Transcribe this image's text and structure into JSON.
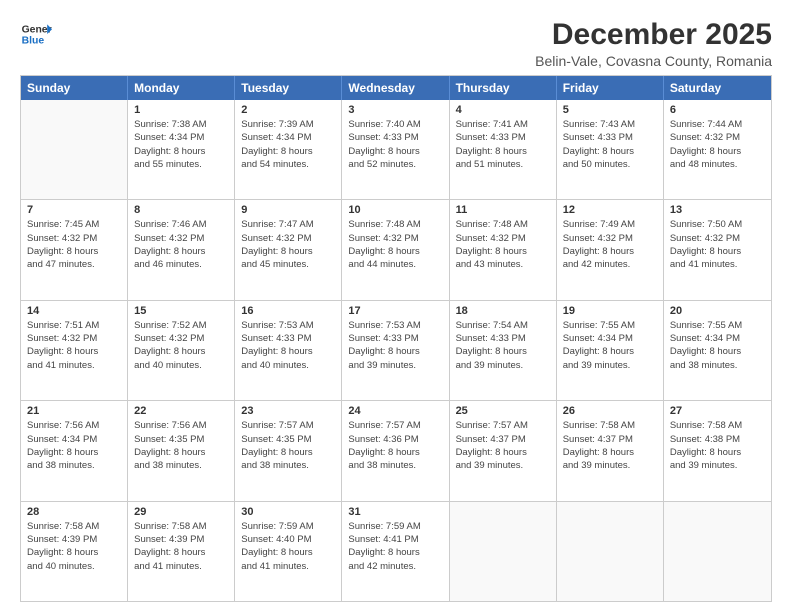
{
  "logo": {
    "line1": "General",
    "line2": "Blue"
  },
  "title": "December 2025",
  "subtitle": "Belin-Vale, Covasna County, Romania",
  "header_days": [
    "Sunday",
    "Monday",
    "Tuesday",
    "Wednesday",
    "Thursday",
    "Friday",
    "Saturday"
  ],
  "weeks": [
    [
      {
        "day": "",
        "info": ""
      },
      {
        "day": "1",
        "info": "Sunrise: 7:38 AM\nSunset: 4:34 PM\nDaylight: 8 hours\nand 55 minutes."
      },
      {
        "day": "2",
        "info": "Sunrise: 7:39 AM\nSunset: 4:34 PM\nDaylight: 8 hours\nand 54 minutes."
      },
      {
        "day": "3",
        "info": "Sunrise: 7:40 AM\nSunset: 4:33 PM\nDaylight: 8 hours\nand 52 minutes."
      },
      {
        "day": "4",
        "info": "Sunrise: 7:41 AM\nSunset: 4:33 PM\nDaylight: 8 hours\nand 51 minutes."
      },
      {
        "day": "5",
        "info": "Sunrise: 7:43 AM\nSunset: 4:33 PM\nDaylight: 8 hours\nand 50 minutes."
      },
      {
        "day": "6",
        "info": "Sunrise: 7:44 AM\nSunset: 4:32 PM\nDaylight: 8 hours\nand 48 minutes."
      }
    ],
    [
      {
        "day": "7",
        "info": "Sunrise: 7:45 AM\nSunset: 4:32 PM\nDaylight: 8 hours\nand 47 minutes."
      },
      {
        "day": "8",
        "info": "Sunrise: 7:46 AM\nSunset: 4:32 PM\nDaylight: 8 hours\nand 46 minutes."
      },
      {
        "day": "9",
        "info": "Sunrise: 7:47 AM\nSunset: 4:32 PM\nDaylight: 8 hours\nand 45 minutes."
      },
      {
        "day": "10",
        "info": "Sunrise: 7:48 AM\nSunset: 4:32 PM\nDaylight: 8 hours\nand 44 minutes."
      },
      {
        "day": "11",
        "info": "Sunrise: 7:48 AM\nSunset: 4:32 PM\nDaylight: 8 hours\nand 43 minutes."
      },
      {
        "day": "12",
        "info": "Sunrise: 7:49 AM\nSunset: 4:32 PM\nDaylight: 8 hours\nand 42 minutes."
      },
      {
        "day": "13",
        "info": "Sunrise: 7:50 AM\nSunset: 4:32 PM\nDaylight: 8 hours\nand 41 minutes."
      }
    ],
    [
      {
        "day": "14",
        "info": "Sunrise: 7:51 AM\nSunset: 4:32 PM\nDaylight: 8 hours\nand 41 minutes."
      },
      {
        "day": "15",
        "info": "Sunrise: 7:52 AM\nSunset: 4:32 PM\nDaylight: 8 hours\nand 40 minutes."
      },
      {
        "day": "16",
        "info": "Sunrise: 7:53 AM\nSunset: 4:33 PM\nDaylight: 8 hours\nand 40 minutes."
      },
      {
        "day": "17",
        "info": "Sunrise: 7:53 AM\nSunset: 4:33 PM\nDaylight: 8 hours\nand 39 minutes."
      },
      {
        "day": "18",
        "info": "Sunrise: 7:54 AM\nSunset: 4:33 PM\nDaylight: 8 hours\nand 39 minutes."
      },
      {
        "day": "19",
        "info": "Sunrise: 7:55 AM\nSunset: 4:34 PM\nDaylight: 8 hours\nand 39 minutes."
      },
      {
        "day": "20",
        "info": "Sunrise: 7:55 AM\nSunset: 4:34 PM\nDaylight: 8 hours\nand 38 minutes."
      }
    ],
    [
      {
        "day": "21",
        "info": "Sunrise: 7:56 AM\nSunset: 4:34 PM\nDaylight: 8 hours\nand 38 minutes."
      },
      {
        "day": "22",
        "info": "Sunrise: 7:56 AM\nSunset: 4:35 PM\nDaylight: 8 hours\nand 38 minutes."
      },
      {
        "day": "23",
        "info": "Sunrise: 7:57 AM\nSunset: 4:35 PM\nDaylight: 8 hours\nand 38 minutes."
      },
      {
        "day": "24",
        "info": "Sunrise: 7:57 AM\nSunset: 4:36 PM\nDaylight: 8 hours\nand 38 minutes."
      },
      {
        "day": "25",
        "info": "Sunrise: 7:57 AM\nSunset: 4:37 PM\nDaylight: 8 hours\nand 39 minutes."
      },
      {
        "day": "26",
        "info": "Sunrise: 7:58 AM\nSunset: 4:37 PM\nDaylight: 8 hours\nand 39 minutes."
      },
      {
        "day": "27",
        "info": "Sunrise: 7:58 AM\nSunset: 4:38 PM\nDaylight: 8 hours\nand 39 minutes."
      }
    ],
    [
      {
        "day": "28",
        "info": "Sunrise: 7:58 AM\nSunset: 4:39 PM\nDaylight: 8 hours\nand 40 minutes."
      },
      {
        "day": "29",
        "info": "Sunrise: 7:58 AM\nSunset: 4:39 PM\nDaylight: 8 hours\nand 41 minutes."
      },
      {
        "day": "30",
        "info": "Sunrise: 7:59 AM\nSunset: 4:40 PM\nDaylight: 8 hours\nand 41 minutes."
      },
      {
        "day": "31",
        "info": "Sunrise: 7:59 AM\nSunset: 4:41 PM\nDaylight: 8 hours\nand 42 minutes."
      },
      {
        "day": "",
        "info": ""
      },
      {
        "day": "",
        "info": ""
      },
      {
        "day": "",
        "info": ""
      }
    ]
  ]
}
